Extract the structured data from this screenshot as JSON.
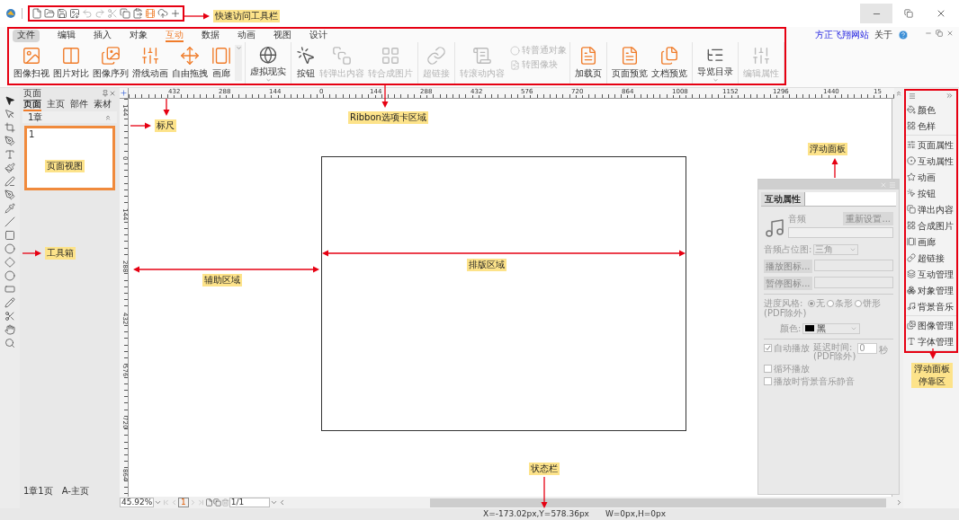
{
  "ribbon": {
    "tabs": [
      {
        "label": "文件",
        "kind": "file",
        "selected": false
      },
      {
        "label": "编辑",
        "kind": "tab",
        "selected": false
      },
      {
        "label": "插入",
        "kind": "tab",
        "selected": false
      },
      {
        "label": "对象",
        "kind": "tab",
        "selected": false
      },
      {
        "label": "互动",
        "kind": "tab",
        "selected": true
      },
      {
        "label": "数据",
        "kind": "tab",
        "selected": false
      },
      {
        "label": "动画",
        "kind": "tab",
        "selected": false
      },
      {
        "label": "视图",
        "kind": "tab",
        "selected": false
      },
      {
        "label": "设计",
        "kind": "tab",
        "selected": false
      }
    ],
    "links": [
      {
        "label": "方正飞翔网站",
        "kind": "link"
      },
      {
        "label": "关于",
        "kind": "text"
      }
    ],
    "groups": [
      [
        {
          "label": "图像扫视",
          "kind": "large",
          "disabled": false
        },
        {
          "label": "图片对比",
          "kind": "large",
          "disabled": false
        },
        {
          "label": "图像序列",
          "kind": "large",
          "disabled": false
        },
        {
          "label": "滑线动画",
          "kind": "large",
          "disabled": false
        },
        {
          "label": "自由拖拽",
          "kind": "large",
          "disabled": false
        },
        {
          "label": "画廊",
          "kind": "large",
          "disabled": false
        }
      ],
      [
        {
          "label": "虚拟现实",
          "kind": "large",
          "disabled": false,
          "dropdown": true
        }
      ],
      [
        {
          "label": "按钮",
          "kind": "large",
          "disabled": false
        },
        {
          "label": "转弹出内容",
          "kind": "large",
          "disabled": true
        },
        {
          "label": "转合成图片",
          "kind": "large",
          "disabled": true
        }
      ],
      [
        {
          "label": "超链接",
          "kind": "large",
          "disabled": true
        }
      ],
      [
        {
          "label": "转滚动内容",
          "kind": "large",
          "disabled": true
        },
        {
          "label": "转普通对象",
          "kind": "small",
          "disabled": true
        },
        {
          "label": "转图像块",
          "kind": "small",
          "disabled": true
        }
      ],
      [
        {
          "label": "加载页",
          "kind": "large",
          "disabled": false
        }
      ],
      [
        {
          "label": "页面预览",
          "kind": "large",
          "disabled": false
        },
        {
          "label": "文档预览",
          "kind": "large",
          "disabled": false
        }
      ],
      [
        {
          "label": "导览目录",
          "kind": "large",
          "disabled": false,
          "dropdown": true
        }
      ],
      [
        {
          "label": "编辑属性",
          "kind": "large",
          "disabled": true
        }
      ]
    ]
  },
  "page_panel": {
    "title": "页面",
    "tabs": [
      {
        "label": "页面",
        "selected": true
      },
      {
        "label": "主页",
        "selected": false
      },
      {
        "label": "部件",
        "selected": false
      },
      {
        "label": "素材",
        "selected": false
      }
    ],
    "chapter": "1章",
    "pages": [
      {
        "number": "1",
        "selected": true
      }
    ],
    "footer": [
      "1章1页",
      "A-主页"
    ]
  },
  "rulers": {
    "horizontal": [
      "432",
      "288",
      "144",
      "0",
      "144",
      "288",
      "432",
      "576",
      "720",
      "864",
      "1008",
      "1152",
      "1296",
      "1440",
      "15"
    ],
    "vertical": [
      "144",
      "0",
      "144",
      "288",
      "432",
      "576",
      "720",
      "864"
    ]
  },
  "bottom_bar": {
    "zoom": "45.92%",
    "page": "1",
    "page_count": "1/1"
  },
  "floating_panel": {
    "tab": "互动属性",
    "audio_label": "音频",
    "reset_button": "重新设置...",
    "placeholder_label": "音频占位图:",
    "placeholder_value": "三角",
    "play_icon_button": "播放图标...",
    "pause_icon_button": "暂停图标...",
    "progress_label": "进度风格:",
    "progress_note": "(PDF除外)",
    "progress_options": [
      {
        "label": "无",
        "selected": true
      },
      {
        "label": "条形",
        "selected": false
      },
      {
        "label": "饼形",
        "selected": false
      }
    ],
    "color_label": "颜色:",
    "color_value": "黑",
    "delay_label": "延迟时间:",
    "delay_note": "(PDF除外)",
    "delay_value": "0",
    "delay_unit": "秒",
    "checkboxes": [
      {
        "label": "自动播放",
        "checked": true
      },
      {
        "label": "循环播放",
        "checked": false
      },
      {
        "label": "播放时背景音乐静音",
        "checked": false
      }
    ]
  },
  "dock": {
    "groups": [
      [
        "颜色",
        "色样"
      ],
      [
        "页面属性",
        "互动属性",
        "动画",
        "按钮",
        "弹出内容",
        "合成图片",
        "画廊",
        "超链接",
        "互动管理",
        "对象管理",
        "背景音乐"
      ],
      [
        "图像管理",
        "字体管理"
      ]
    ]
  },
  "status_bar": [
    "X=-173.02px,Y=578.36px",
    "W=0px,H=0px"
  ],
  "callouts": [
    "快速访问工具栏",
    "Ribbon选项卡区域",
    "标尺",
    "页面视图",
    "浮动面板",
    "工具箱",
    "排版区域",
    "辅助区域",
    "浮动面板停靠区",
    "状态栏"
  ]
}
